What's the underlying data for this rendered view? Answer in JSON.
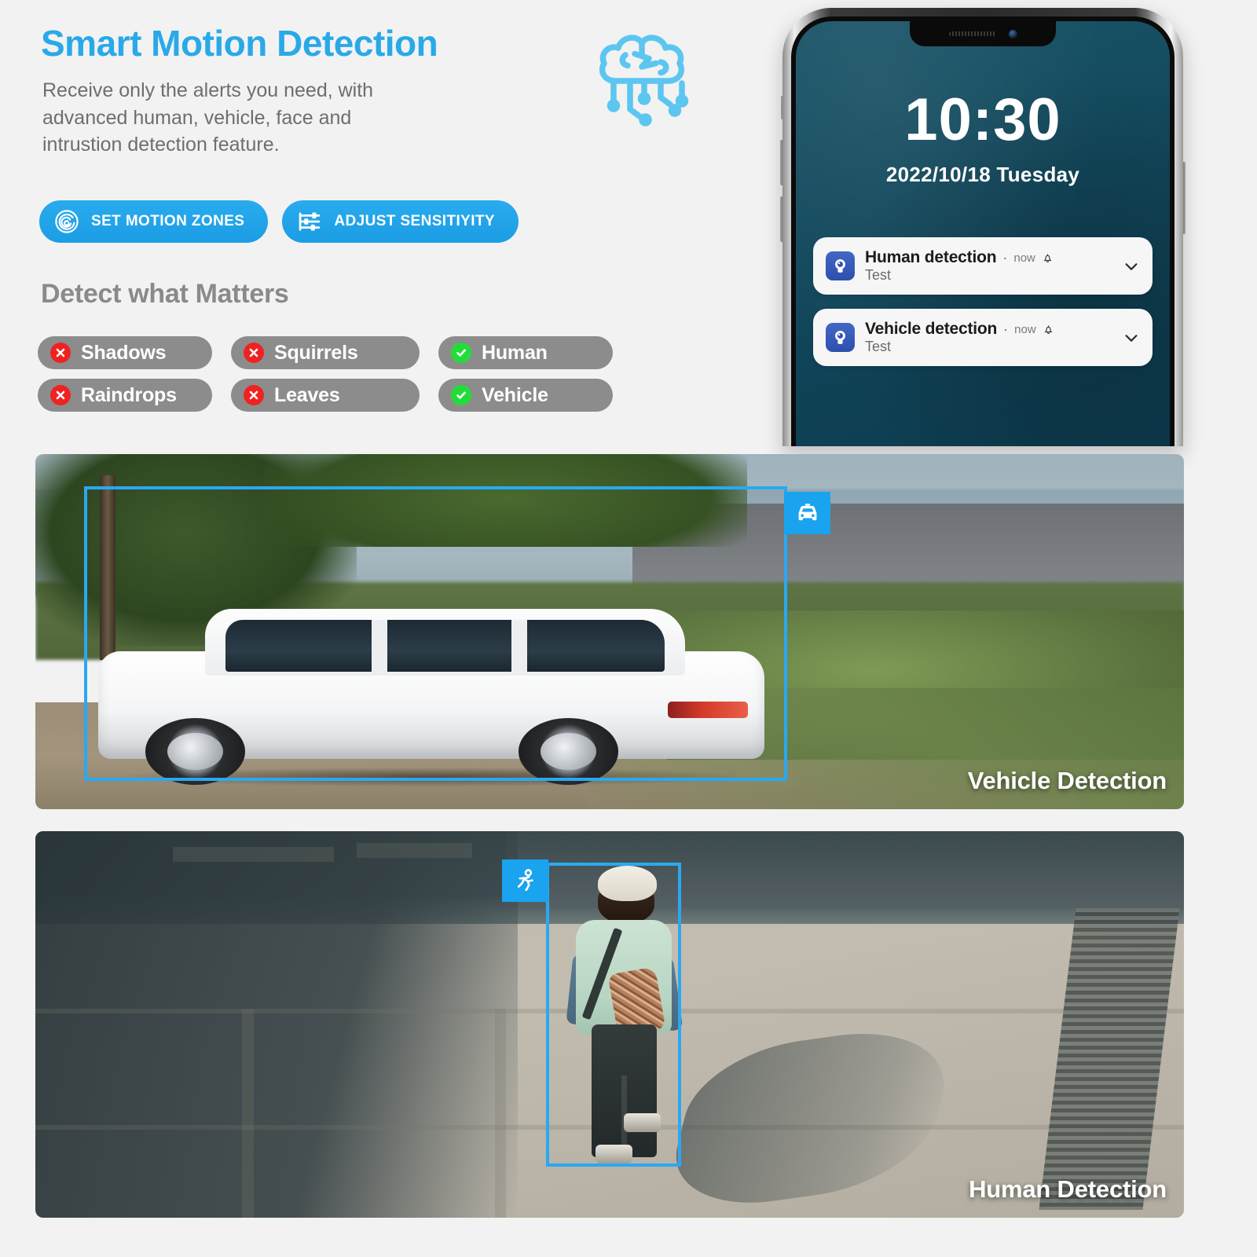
{
  "header": {
    "title": "Smart Motion Detection",
    "subtitle": "Receive only the alerts you need, with advanced human, vehicle, face and intrustion detection feature.",
    "ai_icon": "ai-brain-icon",
    "accent_color": "#29a9e8"
  },
  "cta_buttons": [
    {
      "label": "SET MOTION ZONES",
      "icon": "motion-radar-icon"
    },
    {
      "label": "ADJUST SENSITIYITY",
      "icon": "sliders-icon"
    }
  ],
  "detect_section": {
    "title": "Detect what Matters",
    "chips": [
      {
        "label": "Shadows",
        "state": "no",
        "icon": "cross-circle-icon"
      },
      {
        "label": "Squirrels",
        "state": "no",
        "icon": "cross-circle-icon"
      },
      {
        "label": "Human",
        "state": "yes",
        "icon": "check-circle-icon"
      },
      {
        "label": "Raindrops",
        "state": "no",
        "icon": "cross-circle-icon"
      },
      {
        "label": "Leaves",
        "state": "no",
        "icon": "cross-circle-icon"
      },
      {
        "label": "Vehicle",
        "state": "yes",
        "icon": "check-circle-icon"
      }
    ],
    "no_color": "#ef2222",
    "yes_color": "#22dd39",
    "chip_bg": "#8c8c8c"
  },
  "phone": {
    "lock_time": "10:30",
    "lock_date": "2022/10/18  Tuesday",
    "wallpaper_color": "#12485c",
    "notifications": [
      {
        "app_icon": "camera-app-icon",
        "title": "Human detection",
        "separator": "·",
        "time": "now",
        "bell_icon": "bell-icon",
        "body": "Test",
        "expand_icon": "chevron-down-icon"
      },
      {
        "app_icon": "camera-app-icon",
        "title": "Vehicle detection",
        "separator": "·",
        "time": "now",
        "bell_icon": "bell-icon",
        "body": "Test",
        "expand_icon": "chevron-down-icon"
      }
    ]
  },
  "scenes": [
    {
      "label": "Vehicle Detection",
      "tag_icon": "car-front-icon",
      "box_color": "#2aa8f2",
      "tag_color": "#1aa3ef"
    },
    {
      "label": "Human Detection",
      "tag_icon": "running-person-icon",
      "box_color": "#2aa8f2",
      "tag_color": "#1aa3ef"
    }
  ]
}
